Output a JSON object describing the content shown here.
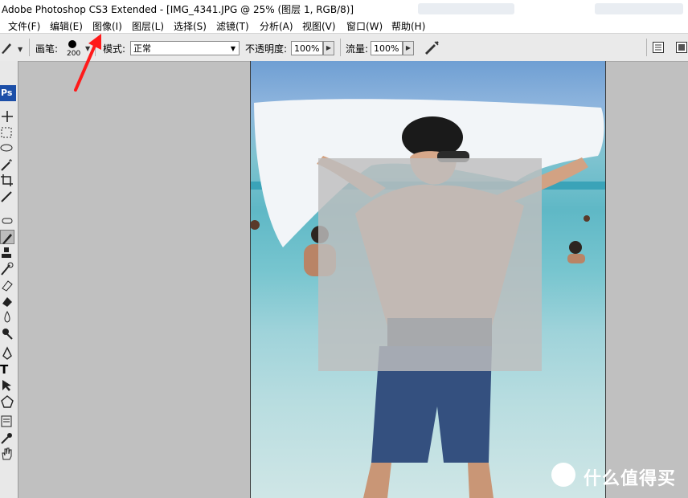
{
  "window": {
    "title": "Adobe Photoshop CS3 Extended - [IMG_4341.JPG @ 25% (图层 1, RGB/8)]"
  },
  "menu": {
    "items": [
      "文件(F)",
      "编辑(E)",
      "图像(I)",
      "图层(L)",
      "选择(S)",
      "滤镜(T)",
      "分析(A)",
      "视图(V)",
      "窗口(W)",
      "帮助(H)"
    ]
  },
  "options": {
    "brush_label": "画笔:",
    "brush_size": "200",
    "mode_label": "模式:",
    "mode_value": "正常",
    "opacity_label": "不透明度:",
    "opacity_value": "100%",
    "flow_label": "流量:",
    "flow_value": "100%"
  },
  "toolbox": {
    "logo": "Ps",
    "tools": [
      "move-tool",
      "marquee-tool",
      "lasso-tool",
      "magic-wand-tool",
      "crop-tool",
      "slice-tool",
      "healing-brush-tool",
      "brush-tool",
      "stamp-tool",
      "history-brush-tool",
      "eraser-tool",
      "gradient-tool",
      "blur-tool",
      "dodge-tool",
      "pen-tool",
      "type-tool",
      "path-selection-tool",
      "shape-tool",
      "notes-tool",
      "eyedropper-tool",
      "hand-tool"
    ],
    "type_glyph": "T"
  },
  "annotation": {
    "color": "#ff1a1a",
    "points_to": "图像(I)"
  },
  "watermark": {
    "text": "什么值得买"
  },
  "colors": {
    "ps_blue": "#1c4fa8",
    "workspace_gray": "#c0c0c0"
  }
}
